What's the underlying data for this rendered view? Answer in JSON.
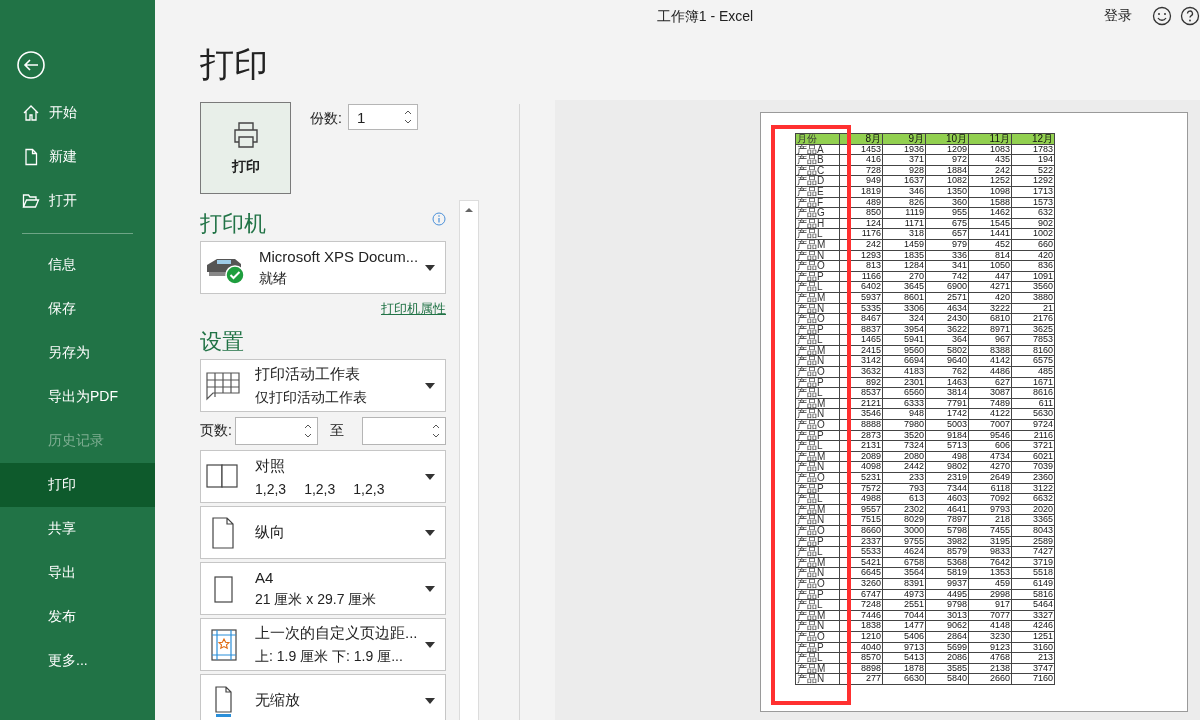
{
  "window": {
    "title": "工作簿1 - Excel",
    "account": "登录"
  },
  "sidebar": {
    "top_items": [
      {
        "label": "开始",
        "kind": "home",
        "selected": false
      },
      {
        "label": "新建",
        "kind": "new",
        "selected": false
      },
      {
        "label": "打开",
        "kind": "open",
        "selected": false
      }
    ],
    "items": [
      {
        "label": "信息",
        "selected": false,
        "disabled": false
      },
      {
        "label": "保存",
        "selected": false,
        "disabled": false
      },
      {
        "label": "另存为",
        "selected": false,
        "disabled": false
      },
      {
        "label": "导出为PDF",
        "selected": false,
        "disabled": false
      },
      {
        "label": "历史记录",
        "selected": false,
        "disabled": true
      },
      {
        "label": "打印",
        "selected": true,
        "disabled": false
      },
      {
        "label": "共享",
        "selected": false,
        "disabled": false
      },
      {
        "label": "导出",
        "selected": false,
        "disabled": false
      },
      {
        "label": "发布",
        "selected": false,
        "disabled": false
      },
      {
        "label": "更多...",
        "selected": false,
        "disabled": false
      }
    ]
  },
  "print": {
    "heading": "打印",
    "button": "打印",
    "copies_label": "份数:",
    "copies": "1"
  },
  "printer": {
    "heading": "打印机",
    "name": "Microsoft XPS Docum...",
    "status": "就绪",
    "properties_link": "打印机属性"
  },
  "settings": {
    "heading": "设置",
    "scope": {
      "kind": "sheets",
      "title": "打印活动工作表",
      "subtitle": "仅打印活动工作表"
    },
    "pages": {
      "label": "页数:",
      "to": "至"
    },
    "options": [
      {
        "kind": "collate",
        "title": "对照",
        "groups": [
          "1,2,3",
          "1,2,3",
          "1,2,3"
        ]
      },
      {
        "kind": "portrait",
        "title": "纵向"
      },
      {
        "kind": "paper",
        "title": "A4",
        "subtitle": "21 厘米 x 29.7 厘米"
      },
      {
        "kind": "margins",
        "title": "上一次的自定义页边距...",
        "subtitle": "上: 1.9 厘米 下: 1.9 厘..."
      },
      {
        "kind": "scaling",
        "title": "无缩放"
      }
    ]
  },
  "preview": {
    "table": {
      "columns": [
        "月份",
        "8月",
        "9月",
        "10月",
        "11月",
        "12月"
      ],
      "rows": [
        [
          "产品A",
          "1453",
          "1936",
          "1209",
          "1083",
          "1783"
        ],
        [
          "产品B",
          "416",
          "371",
          "972",
          "435",
          "194"
        ],
        [
          "产品C",
          "728",
          "928",
          "1884",
          "242",
          "522"
        ],
        [
          "产品D",
          "949",
          "1637",
          "1082",
          "1252",
          "1292"
        ],
        [
          "产品E",
          "1819",
          "346",
          "1350",
          "1098",
          "1713"
        ],
        [
          "产品F",
          "489",
          "826",
          "360",
          "1588",
          "1573"
        ],
        [
          "产品G",
          "850",
          "1119",
          "955",
          "1462",
          "632"
        ],
        [
          "产品H",
          "124",
          "1171",
          "675",
          "1545",
          "902"
        ],
        [
          "产品L",
          "1176",
          "318",
          "657",
          "1441",
          "1002"
        ],
        [
          "产品M",
          "242",
          "1459",
          "979",
          "452",
          "660"
        ],
        [
          "产品N",
          "1293",
          "1835",
          "336",
          "814",
          "420"
        ],
        [
          "产品O",
          "813",
          "1284",
          "341",
          "1050",
          "836"
        ],
        [
          "产品P",
          "1166",
          "270",
          "742",
          "447",
          "1091"
        ],
        [
          "产品L",
          "6402",
          "3645",
          "6900",
          "4271",
          "3560"
        ],
        [
          "产品M",
          "5937",
          "8601",
          "2571",
          "420",
          "3880"
        ],
        [
          "产品N",
          "5335",
          "3306",
          "4634",
          "3222",
          "21"
        ],
        [
          "产品O",
          "8467",
          "324",
          "2430",
          "6810",
          "2176"
        ],
        [
          "产品P",
          "8837",
          "3954",
          "3622",
          "8971",
          "3625"
        ],
        [
          "产品L",
          "1465",
          "5941",
          "364",
          "967",
          "7853"
        ],
        [
          "产品M",
          "2415",
          "9560",
          "5802",
          "8388",
          "8160"
        ],
        [
          "产品N",
          "3142",
          "6694",
          "9640",
          "4142",
          "6575"
        ],
        [
          "产品O",
          "3632",
          "4183",
          "762",
          "4486",
          "485"
        ],
        [
          "产品P",
          "892",
          "2301",
          "1463",
          "627",
          "1671"
        ],
        [
          "产品L",
          "8537",
          "6560",
          "3814",
          "3087",
          "8616"
        ],
        [
          "产品M",
          "2121",
          "6333",
          "7791",
          "7489",
          "611"
        ],
        [
          "产品N",
          "3546",
          "948",
          "1742",
          "4122",
          "5630"
        ],
        [
          "产品O",
          "8888",
          "7980",
          "5003",
          "7007",
          "9724"
        ],
        [
          "产品P",
          "2873",
          "3520",
          "9184",
          "9546",
          "2116"
        ],
        [
          "产品L",
          "2131",
          "7324",
          "5713",
          "606",
          "3721"
        ],
        [
          "产品M",
          "2089",
          "2080",
          "498",
          "4734",
          "6021"
        ],
        [
          "产品N",
          "4098",
          "2442",
          "9802",
          "4270",
          "7039"
        ],
        [
          "产品O",
          "5231",
          "233",
          "2319",
          "2649",
          "2360"
        ],
        [
          "产品P",
          "7572",
          "793",
          "7344",
          "6118",
          "3122"
        ],
        [
          "产品L",
          "4988",
          "613",
          "4603",
          "7092",
          "6632"
        ],
        [
          "产品M",
          "9557",
          "2302",
          "4641",
          "9793",
          "2020"
        ],
        [
          "产品N",
          "7515",
          "8029",
          "7897",
          "218",
          "3365"
        ],
        [
          "产品O",
          "8660",
          "3000",
          "5798",
          "7455",
          "8043"
        ],
        [
          "产品P",
          "2337",
          "9755",
          "3982",
          "3195",
          "2589"
        ],
        [
          "产品L",
          "5533",
          "4624",
          "8579",
          "9833",
          "7427"
        ],
        [
          "产品M",
          "5421",
          "6758",
          "5368",
          "7642",
          "3719"
        ],
        [
          "产品N",
          "6645",
          "3564",
          "5819",
          "1353",
          "5518"
        ],
        [
          "产品O",
          "3260",
          "8391",
          "9937",
          "459",
          "6149"
        ],
        [
          "产品P",
          "6747",
          "4973",
          "4495",
          "2998",
          "5816"
        ],
        [
          "产品L",
          "7248",
          "2551",
          "9798",
          "917",
          "5464"
        ],
        [
          "产品M",
          "7446",
          "7044",
          "3013",
          "7077",
          "3327"
        ],
        [
          "产品N",
          "1838",
          "1477",
          "9062",
          "4148",
          "4246"
        ],
        [
          "产品O",
          "1210",
          "5406",
          "2864",
          "3230",
          "1251"
        ],
        [
          "产品P",
          "4040",
          "9713",
          "5699",
          "9123",
          "3160"
        ],
        [
          "产品L",
          "8570",
          "5413",
          "2086",
          "4768",
          "213"
        ],
        [
          "产品M",
          "8898",
          "1878",
          "3585",
          "2138",
          "3747"
        ],
        [
          "产品N",
          "277",
          "6630",
          "5840",
          "2660",
          "7160"
        ]
      ]
    }
  }
}
